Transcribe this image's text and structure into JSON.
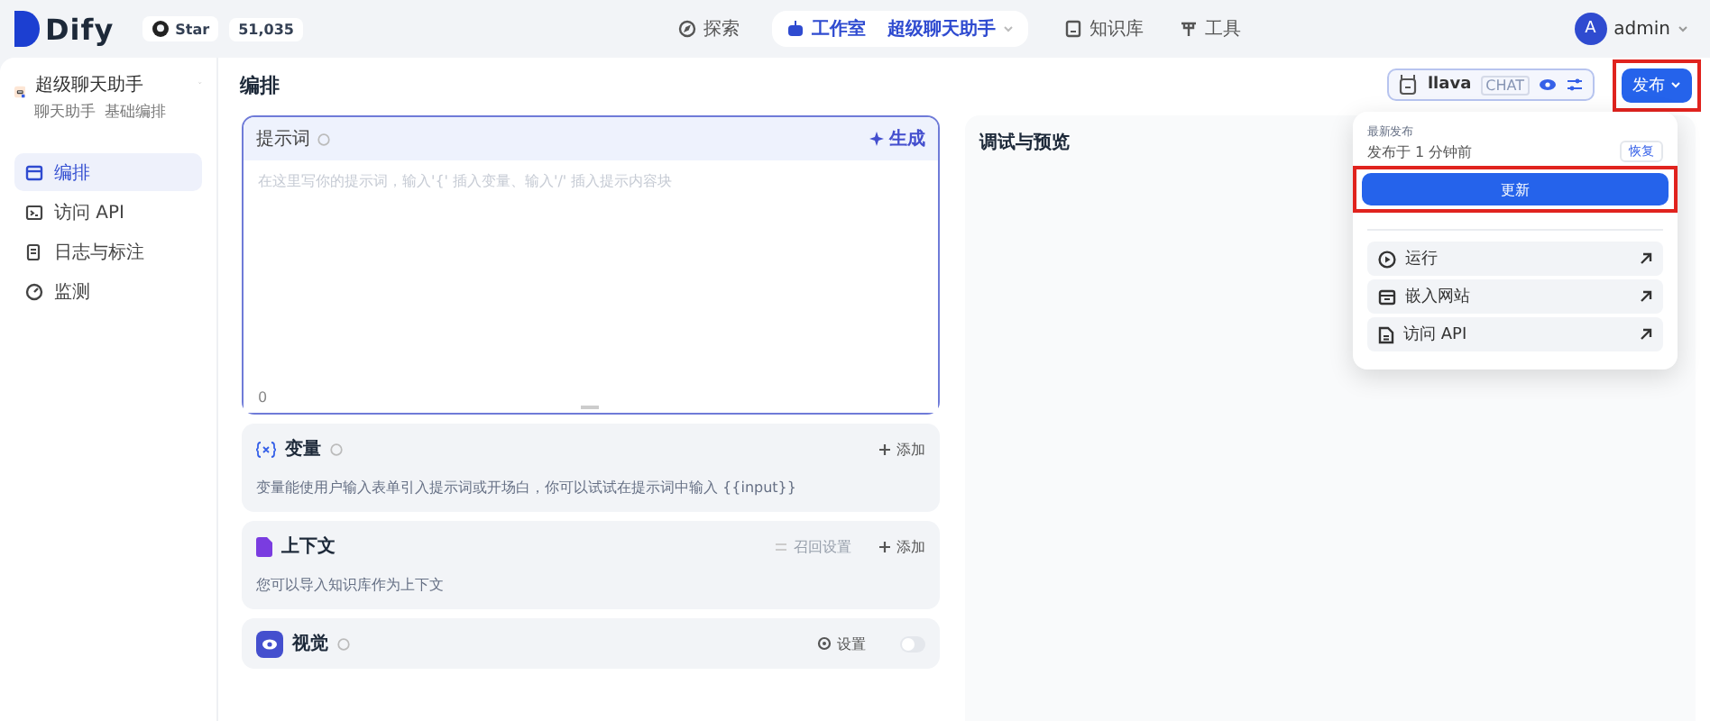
{
  "header": {
    "logo": "Dify",
    "github": {
      "label": "Star",
      "count": "51,035"
    },
    "nav": [
      {
        "label": "探索",
        "selected": false
      },
      {
        "label": "工作室",
        "selected": true,
        "app": "超级聊天助手"
      },
      {
        "label": "知识库",
        "selected": false
      },
      {
        "label": "工具",
        "selected": false
      }
    ],
    "user": {
      "initial": "A",
      "name": "admin"
    }
  },
  "sidebar": {
    "app": {
      "name": "超级聊天助手",
      "type": "聊天助手",
      "mode": "基础编排"
    },
    "items": [
      {
        "label": "编排",
        "selected": true
      },
      {
        "label": "访问 API",
        "selected": false
      },
      {
        "label": "日志与标注",
        "selected": false
      },
      {
        "label": "监测",
        "selected": false
      }
    ]
  },
  "toolbar": {
    "title": "编排",
    "model": {
      "name": "llava",
      "tag": "CHAT"
    },
    "publish": "发布"
  },
  "prompt": {
    "title": "提示词",
    "generate": "生成",
    "placeholder": "在这里写你的提示词，输入'{' 插入变量、输入'/' 插入提示内容块",
    "count": "0"
  },
  "sections": [
    {
      "kind": "variables",
      "title": "变量",
      "actions": [
        "添加"
      ],
      "description": "变量能使用户输入表单引入提示词或开场白，你可以试试在提示词中输入 {{input}}"
    },
    {
      "kind": "context",
      "title": "上下文",
      "actions": [
        "召回设置",
        "添加"
      ],
      "description": "您可以导入知识库作为上下文"
    },
    {
      "kind": "vision",
      "title": "视觉",
      "actions": [
        "设置"
      ],
      "on": false
    }
  ],
  "preview": {
    "title": "调试与预览"
  },
  "popup": {
    "label": "最新发布",
    "published": "发布于 1 分钟前",
    "restore": "恢复",
    "update": "更新",
    "links": [
      {
        "label": "运行"
      },
      {
        "label": "嵌入网站"
      },
      {
        "label": "访问 API"
      }
    ]
  }
}
